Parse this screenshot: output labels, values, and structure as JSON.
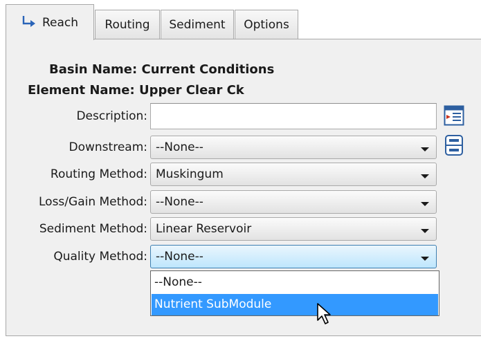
{
  "tabs": [
    {
      "label": "Reach",
      "active": true
    },
    {
      "label": "Routing"
    },
    {
      "label": "Sediment"
    },
    {
      "label": "Options"
    }
  ],
  "basin": {
    "label": "Basin Name:",
    "value": "Current Conditions"
  },
  "element": {
    "label": "Element Name:",
    "value": "Upper Clear Ck"
  },
  "description": {
    "label": "Description:",
    "value": ""
  },
  "downstream": {
    "label": "Downstream:",
    "value": "--None--"
  },
  "routing_method": {
    "label": "Routing Method:",
    "value": "Muskingum"
  },
  "loss_gain_method": {
    "label": "Loss/Gain Method:",
    "value": "--None--"
  },
  "sediment_method": {
    "label": "Sediment Method:",
    "value": "Linear Reservoir"
  },
  "quality_method": {
    "label": "Quality Method:",
    "value": "--None--",
    "options": [
      "--None--",
      "Nutrient SubModule"
    ],
    "highlighted": "Nutrient SubModule"
  },
  "icons": {
    "description_button": "description-editor-icon",
    "downstream_button": "select-downstream-icon"
  },
  "colors": {
    "highlight": "#3399ff",
    "open_combo": "#bee6fd",
    "panel": "#f0f0f0"
  }
}
